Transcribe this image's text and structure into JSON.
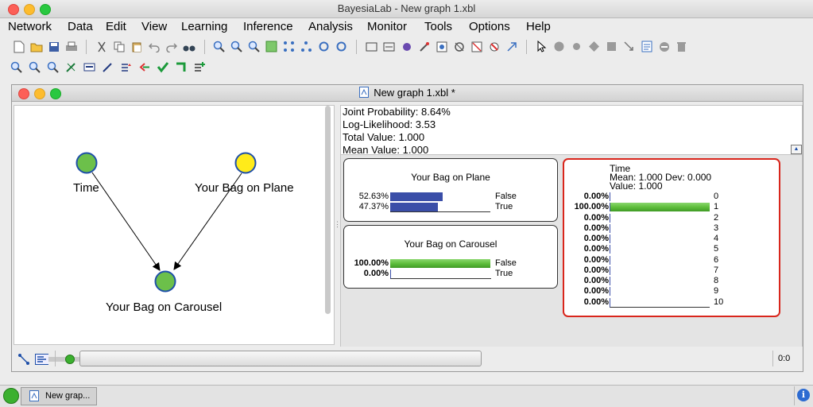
{
  "app": {
    "title": "BayesiaLab - New graph 1.xbl"
  },
  "menu": [
    "Network",
    "Data",
    "Edit",
    "View",
    "Learning",
    "Inference",
    "Analysis",
    "Monitor",
    "Tools",
    "Options",
    "Help"
  ],
  "doc": {
    "title": "New graph 1.xbl *"
  },
  "graph": {
    "nodes": [
      {
        "label": "Time",
        "color": "#6cc04a"
      },
      {
        "label": "Your Bag on Plane",
        "color": "#ffeb1a"
      },
      {
        "label": "Your Bag on Carousel",
        "color": "#6cc04a"
      }
    ]
  },
  "stats": {
    "joint": "Joint Probability: 8.64%",
    "loglik": "Log-Likelihood: 3.53",
    "total": "Total Value: 1.000",
    "mean": "Mean Value: 1.000"
  },
  "monitors": {
    "plane": {
      "title": "Your Bag on Plane",
      "rows": [
        {
          "pct": "52.63%",
          "value": 0.5263,
          "label": "False"
        },
        {
          "pct": "47.37%",
          "value": 0.4737,
          "label": "True"
        }
      ]
    },
    "carousel": {
      "title": "Your Bag on Carousel",
      "rows": [
        {
          "pct": "100.00%",
          "value": 1.0,
          "label": "False"
        },
        {
          "pct": "0.00%",
          "value": 0.0,
          "label": "True"
        }
      ]
    },
    "time": {
      "title": "Time",
      "line1": "Mean: 1.000 Dev: 0.000",
      "line2": "Value: 1.000",
      "rows": [
        {
          "pct": "0.00%",
          "value": 0,
          "label": "0"
        },
        {
          "pct": "100.00%",
          "value": 1,
          "label": "1"
        },
        {
          "pct": "0.00%",
          "value": 0,
          "label": "2"
        },
        {
          "pct": "0.00%",
          "value": 0,
          "label": "3"
        },
        {
          "pct": "0.00%",
          "value": 0,
          "label": "4"
        },
        {
          "pct": "0.00%",
          "value": 0,
          "label": "5"
        },
        {
          "pct": "0.00%",
          "value": 0,
          "label": "6"
        },
        {
          "pct": "0.00%",
          "value": 0,
          "label": "7"
        },
        {
          "pct": "0.00%",
          "value": 0,
          "label": "8"
        },
        {
          "pct": "0.00%",
          "value": 0,
          "label": "9"
        },
        {
          "pct": "0.00%",
          "value": 0,
          "label": "10"
        }
      ]
    }
  },
  "status": {
    "coords": "0:0"
  },
  "taskbar": {
    "item": "New grap..."
  },
  "colors": {
    "blue_bar": "#3a4ea8",
    "green_bar": "#5fbf3c",
    "selected_border": "#d9261c"
  }
}
